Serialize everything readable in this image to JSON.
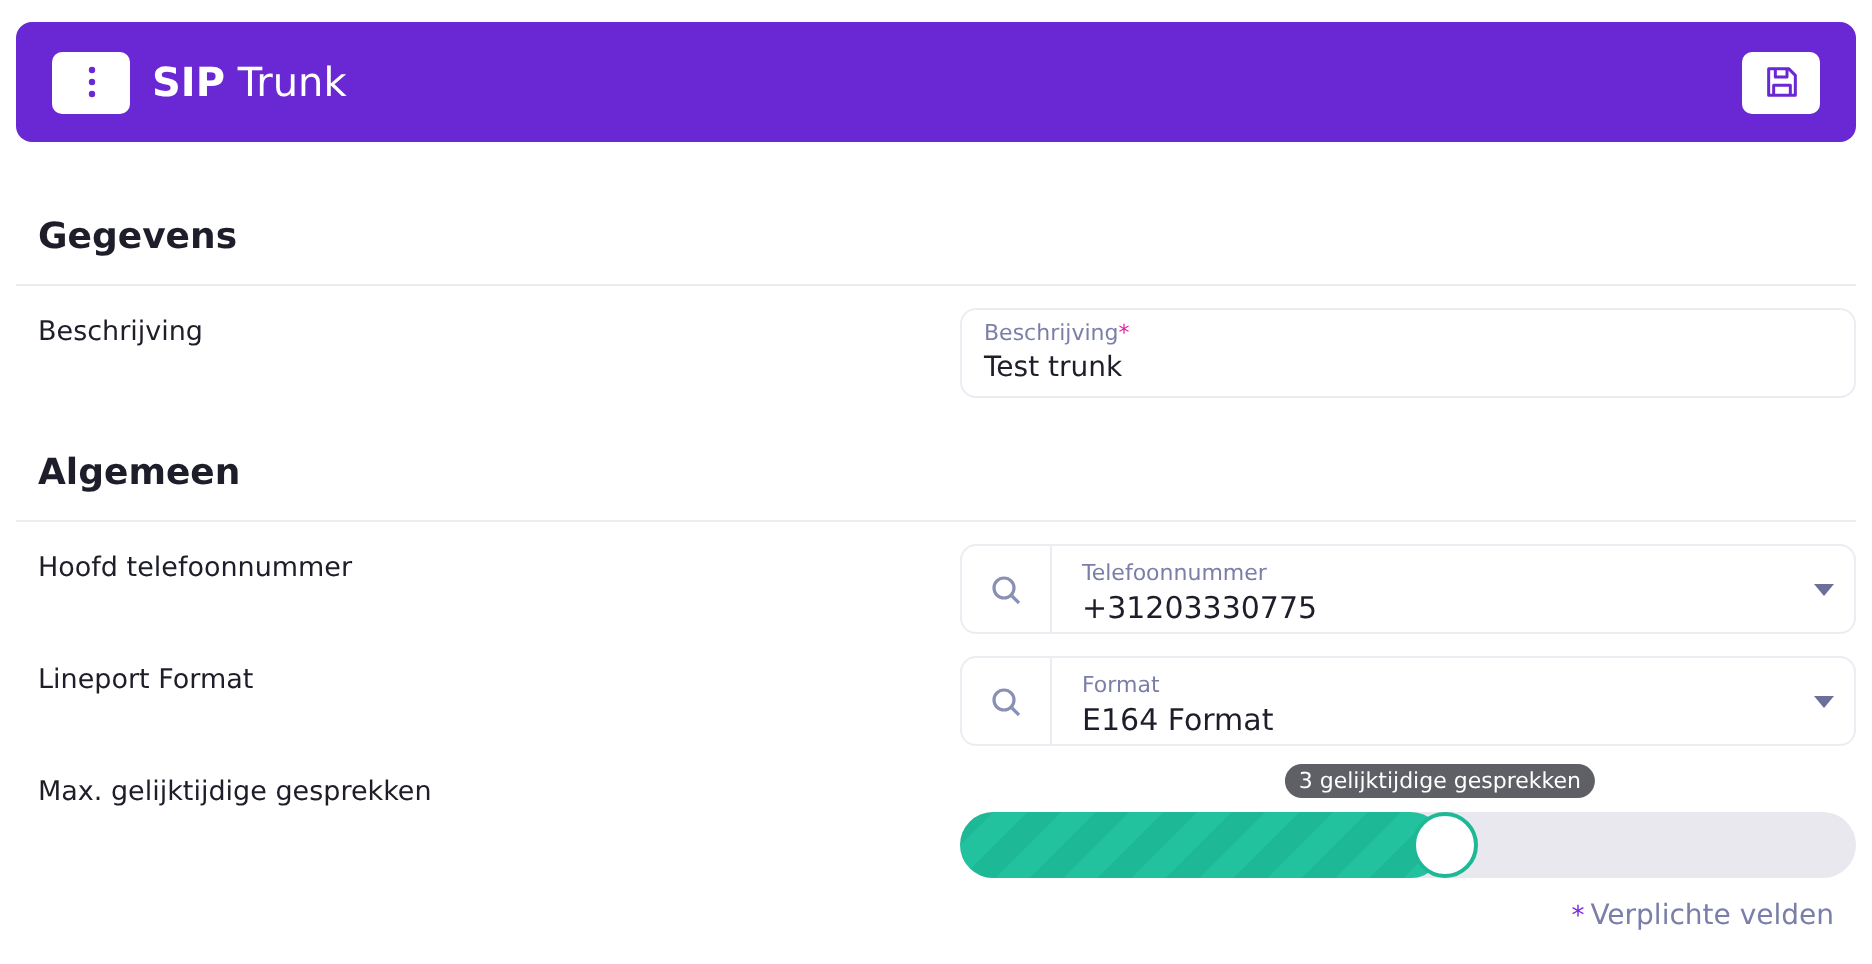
{
  "header": {
    "title_bold": "SIP",
    "title": "Trunk"
  },
  "sections": [
    {
      "title": "Gegevens",
      "rows": [
        {
          "label": "Beschrijving",
          "field": {
            "kind": "text",
            "label": "Beschrijving",
            "required_mark": "*",
            "value": "Test trunk"
          }
        }
      ]
    },
    {
      "title": "Algemeen",
      "rows": [
        {
          "label": "Hoofd telefoonnummer",
          "field": {
            "kind": "select",
            "label": "Telefoonnummer",
            "value": "+31203330775"
          }
        },
        {
          "label": "Lineport Format",
          "field": {
            "kind": "select",
            "label": "Format",
            "value": "E164 Format"
          }
        },
        {
          "label": "Max. gelijktijdige gesprekken",
          "field": {
            "kind": "slider",
            "level": 0.54,
            "tooltip": "3 gelijktijdige gesprekken"
          }
        }
      ]
    }
  ],
  "footer": {
    "mark": "*",
    "text": "Verplichte velden"
  }
}
